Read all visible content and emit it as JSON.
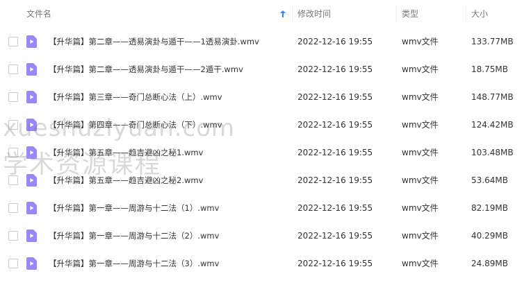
{
  "header": {
    "name_label": "文件名",
    "time_label": "修改时间",
    "type_label": "类型",
    "size_label": "大小"
  },
  "colors": {
    "file_icon": "#9b87f5",
    "sort_arrow": "#3b82f6",
    "watermark": "#888888"
  },
  "files": [
    {
      "name": "【升华篇】第二章——透易演卦与遁干——1透易演卦.wmv",
      "time": "2022-12-16 19:55",
      "type": "wmv文件",
      "size": "133.77MB"
    },
    {
      "name": "【升华篇】第二章——透易演卦与遁干——2遁干.wmv",
      "time": "2022-12-16 19:55",
      "type": "wmv文件",
      "size": "18.75MB"
    },
    {
      "name": "【升华篇】第三章——奇门总断心法（上）.wmv",
      "time": "2022-12-16 19:55",
      "type": "wmv文件",
      "size": "148.77MB"
    },
    {
      "name": "【升华篇】第四章——奇门总断心法（下）.wmv",
      "time": "2022-12-16 19:55",
      "type": "wmv文件",
      "size": "124.42MB"
    },
    {
      "name": "【升华篇】第五章——趋吉避凶之秘1.wmv",
      "time": "2022-12-16 19:55",
      "type": "wmv文件",
      "size": "103.48MB"
    },
    {
      "name": "【升华篇】第五章——趋吉避凶之秘2.wmv",
      "time": "2022-12-16 19:55",
      "type": "wmv文件",
      "size": "53.64MB"
    },
    {
      "name": "【升华篇】第一章——周游与十二法（1）.wmv",
      "time": "2022-12-16 19:55",
      "type": "wmv文件",
      "size": "82.19MB"
    },
    {
      "name": "【升华篇】第一章——周游与十二法（2）.wmv",
      "time": "2022-12-16 19:55",
      "type": "wmv文件",
      "size": "40.29MB"
    },
    {
      "name": "【升华篇】第一章——周游与十二法（3）.wmv",
      "time": "2022-12-16 19:55",
      "type": "wmv文件",
      "size": "24.89MB"
    }
  ],
  "watermark": {
    "line1": "xueshuziyuan.com",
    "line2": "学术资源课程"
  }
}
